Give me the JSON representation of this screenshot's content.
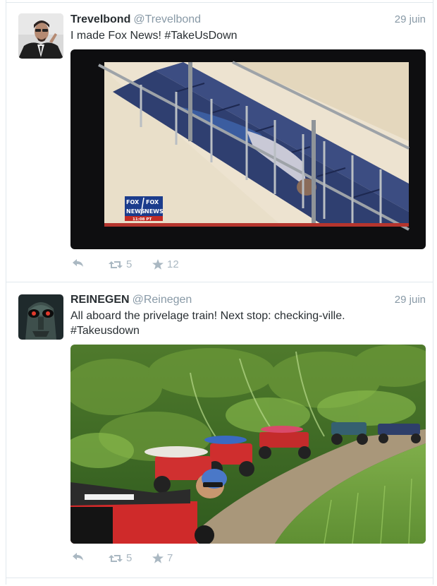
{
  "tweets": [
    {
      "name": "Trevelbond",
      "handle": "@Trevelbond",
      "time": "29 juin",
      "text_lines": [
        "I made Fox News! #TakeUsDown"
      ],
      "media_overlay": {
        "logo_top": "FOX",
        "logo_bottom": "NEWS",
        "clock": "11:08 PT"
      },
      "retweets": "5",
      "favorites": "12"
    },
    {
      "name": "REINEGEN",
      "handle": "@Reinegen",
      "time": "29 juin",
      "text_lines": [
        "All aboard the privelage train! Next stop: checking-ville.",
        "#Takeusdown"
      ],
      "retweets": "5",
      "favorites": "7"
    }
  ],
  "icons": {
    "reply": "reply-arrow-icon",
    "retweet": "retweet-icon",
    "favorite": "star-icon"
  },
  "colors": {
    "name": "#292f33",
    "meta": "#8899a6",
    "action": "#aab8c2",
    "divider": "#e1e8ed"
  }
}
